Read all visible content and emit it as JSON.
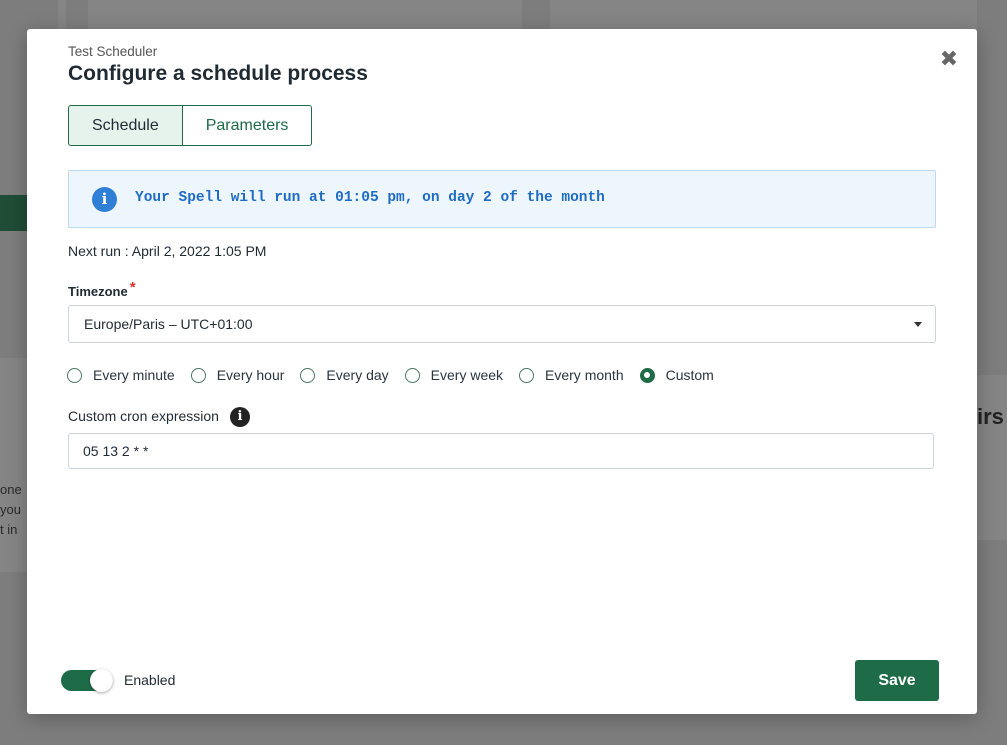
{
  "background": {
    "left_text": [
      "one",
      "you",
      "t in"
    ],
    "right_text": "irs"
  },
  "modal": {
    "subtitle": "Test Scheduler",
    "title": "Configure a schedule process",
    "close_icon": "close-icon",
    "tabs": [
      {
        "label": "Schedule",
        "active": true
      },
      {
        "label": "Parameters",
        "active": false
      }
    ],
    "info": {
      "icon": "info-icon",
      "text": "Your Spell will run at 01:05 pm, on day 2 of the month"
    },
    "next_run": "Next run : April 2, 2022 1:05 PM",
    "timezone": {
      "label": "Timezone",
      "required_mark": "*",
      "value": "Europe/Paris – UTC+01:00"
    },
    "frequency_options": [
      {
        "label": "Every minute",
        "checked": false
      },
      {
        "label": "Every hour",
        "checked": false
      },
      {
        "label": "Every day",
        "checked": false
      },
      {
        "label": "Every week",
        "checked": false
      },
      {
        "label": "Every month",
        "checked": false
      },
      {
        "label": "Custom",
        "checked": true
      }
    ],
    "cron": {
      "label": "Custom cron expression",
      "value": "05 13 2 * *"
    },
    "footer": {
      "enabled_label": "Enabled",
      "enabled": true,
      "save_label": "Save"
    }
  },
  "colors": {
    "accent": "#1e6b47",
    "info_bg": "#edf5fd",
    "info_text": "#1f6cc4",
    "overlay": "#7d7d7d"
  }
}
